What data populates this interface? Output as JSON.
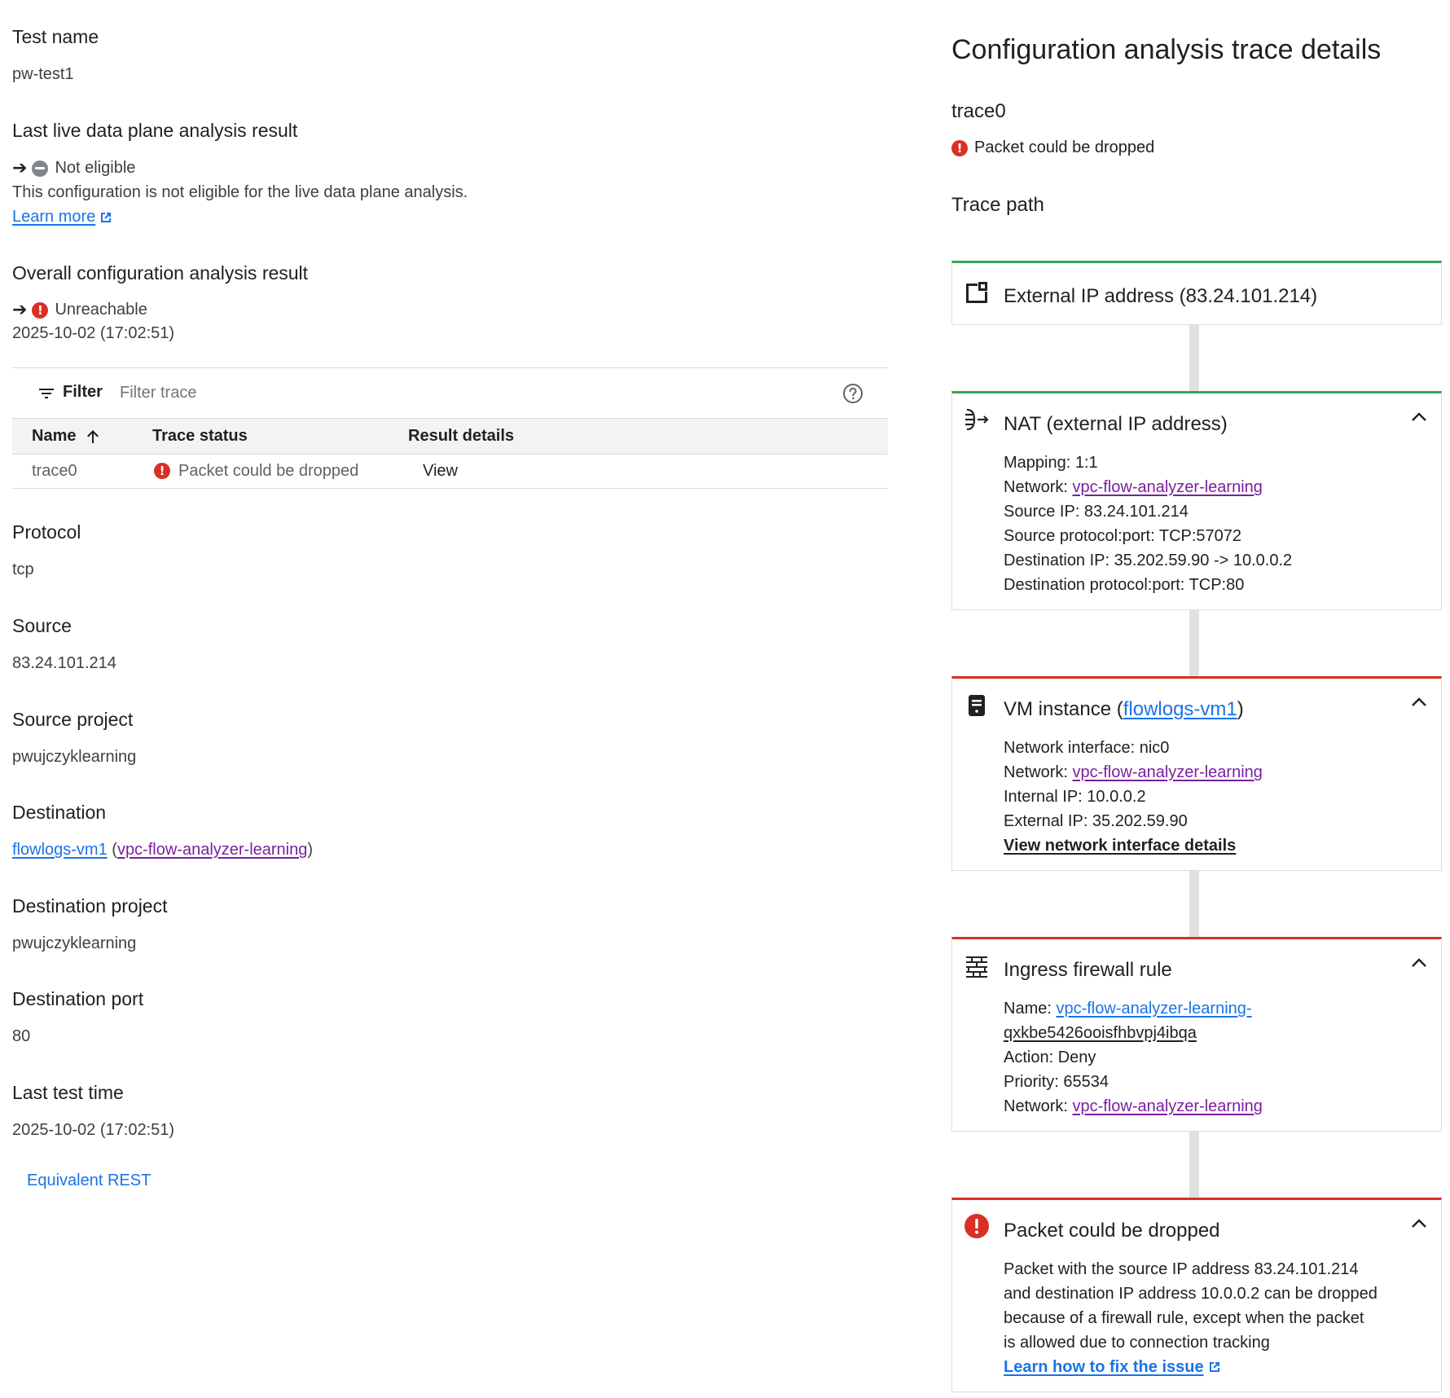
{
  "left": {
    "test_name_label": "Test name",
    "test_name_value": "pw-test1",
    "live_result_label": "Last live data plane analysis result",
    "live_result_status": "Not eligible",
    "live_result_desc": "This configuration is not eligible for the live data plane analysis.",
    "learn_more": "Learn more",
    "overall_label": "Overall configuration analysis result",
    "overall_status": "Unreachable",
    "overall_time": "2025-10-02 (17:02:51)",
    "filter_label": "Filter",
    "filter_placeholder": "Filter trace",
    "table_headers": {
      "name": "Name",
      "trace_status": "Trace status",
      "result_details": "Result details"
    },
    "table_rows": [
      {
        "name": "trace0",
        "status": "Packet could be dropped",
        "details": "View"
      }
    ],
    "protocol_label": "Protocol",
    "protocol_value": "tcp",
    "source_label": "Source",
    "source_value": "83.24.101.214",
    "source_project_label": "Source project",
    "source_project_value": "pwujczyklearning",
    "destination_label": "Destination",
    "destination_vm": "flowlogs-vm1",
    "destination_network": "vpc-flow-analyzer-learning",
    "destination_project_label": "Destination project",
    "destination_project_value": "pwujczyklearning",
    "destination_port_label": "Destination port",
    "destination_port_value": "80",
    "last_test_time_label": "Last test time",
    "last_test_time_value": "2025-10-02 (17:02:51)",
    "equivalent_rest": "Equivalent REST"
  },
  "right": {
    "title": "Configuration analysis trace details",
    "trace_name": "trace0",
    "trace_status": "Packet could be dropped",
    "trace_path_label": "Trace path",
    "cards": {
      "external_ip": {
        "title": "External IP address (83.24.101.214)"
      },
      "nat": {
        "title": "NAT (external IP address)",
        "mapping": "Mapping: 1:1",
        "network_label": "Network: ",
        "network_value": "vpc-flow-analyzer-learning",
        "source_ip": "Source IP: 83.24.101.214",
        "source_pp": "Source protocol:port: TCP:57072",
        "dest_ip": "Destination IP: 35.202.59.90 -> 10.0.0.2",
        "dest_pp": "Destination protocol:port: TCP:80"
      },
      "vm": {
        "title_prefix": "VM instance (",
        "title_link": "flowlogs-vm1",
        "title_suffix": ")",
        "nic": "Network interface: nic0",
        "network_label": "Network: ",
        "network_value": "vpc-flow-analyzer-learning",
        "internal_ip": "Internal IP: 10.0.0.2",
        "external_ip": "External IP: 35.202.59.90",
        "view_nic": "View network interface details"
      },
      "firewall": {
        "title": "Ingress firewall rule",
        "name_label": "Name: ",
        "name_value_1": "vpc-flow-analyzer-learning-",
        "name_value_2": "qxkbe5426ooisfhbvpj4ibqa",
        "action": "Action: Deny",
        "priority": "Priority: 65534",
        "network_label": "Network: ",
        "network_value": "vpc-flow-analyzer-learning"
      },
      "drop": {
        "title": "Packet could be dropped",
        "desc_1": "Packet with the source IP address 83.24.101.214",
        "desc_2": "and destination IP address 10.0.0.2 can be dropped",
        "desc_3": "because of a firewall rule, except when the packet",
        "desc_4": "is allowed due to connection tracking",
        "learn_fix": "Learn how to fix the issue"
      }
    }
  },
  "colors": {
    "accent": "#1a73e8",
    "error": "#d93025",
    "success": "#34a853",
    "visited_link": "#7b1fa2"
  }
}
